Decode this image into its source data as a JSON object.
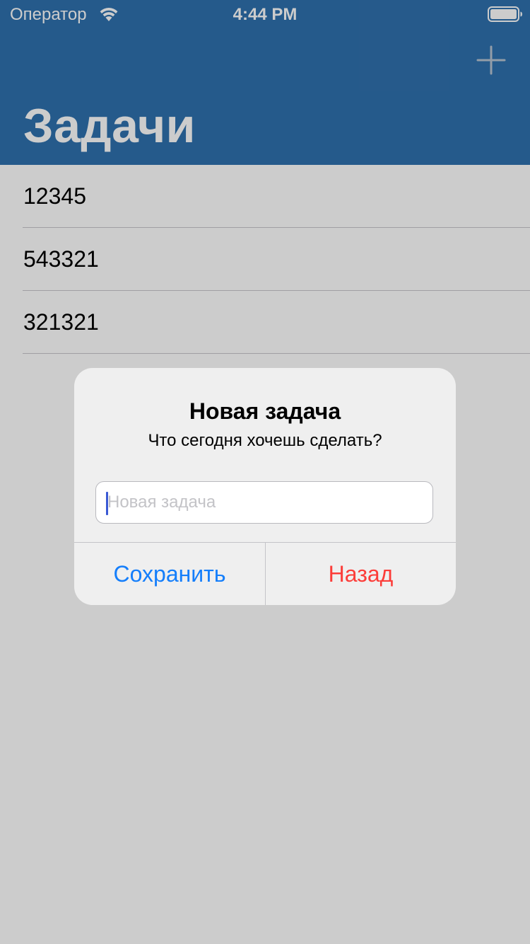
{
  "status_bar": {
    "carrier": "Оператор",
    "time": "4:44 PM",
    "wifi_icon": "wifi-icon",
    "battery_icon": "battery-full-icon"
  },
  "nav": {
    "title": "Задачи",
    "add_icon": "plus-icon",
    "bar_color": "#2f71ae"
  },
  "tasks": [
    {
      "label": "12345"
    },
    {
      "label": "543321"
    },
    {
      "label": "321321"
    }
  ],
  "alert": {
    "title": "Новая задача",
    "message": "Что сегодня хочешь сделать?",
    "input_placeholder": "Новая задача",
    "input_value": "",
    "save_label": "Сохранить",
    "back_label": "Назад",
    "save_color": "#147efb",
    "back_color": "#fc3d39"
  }
}
